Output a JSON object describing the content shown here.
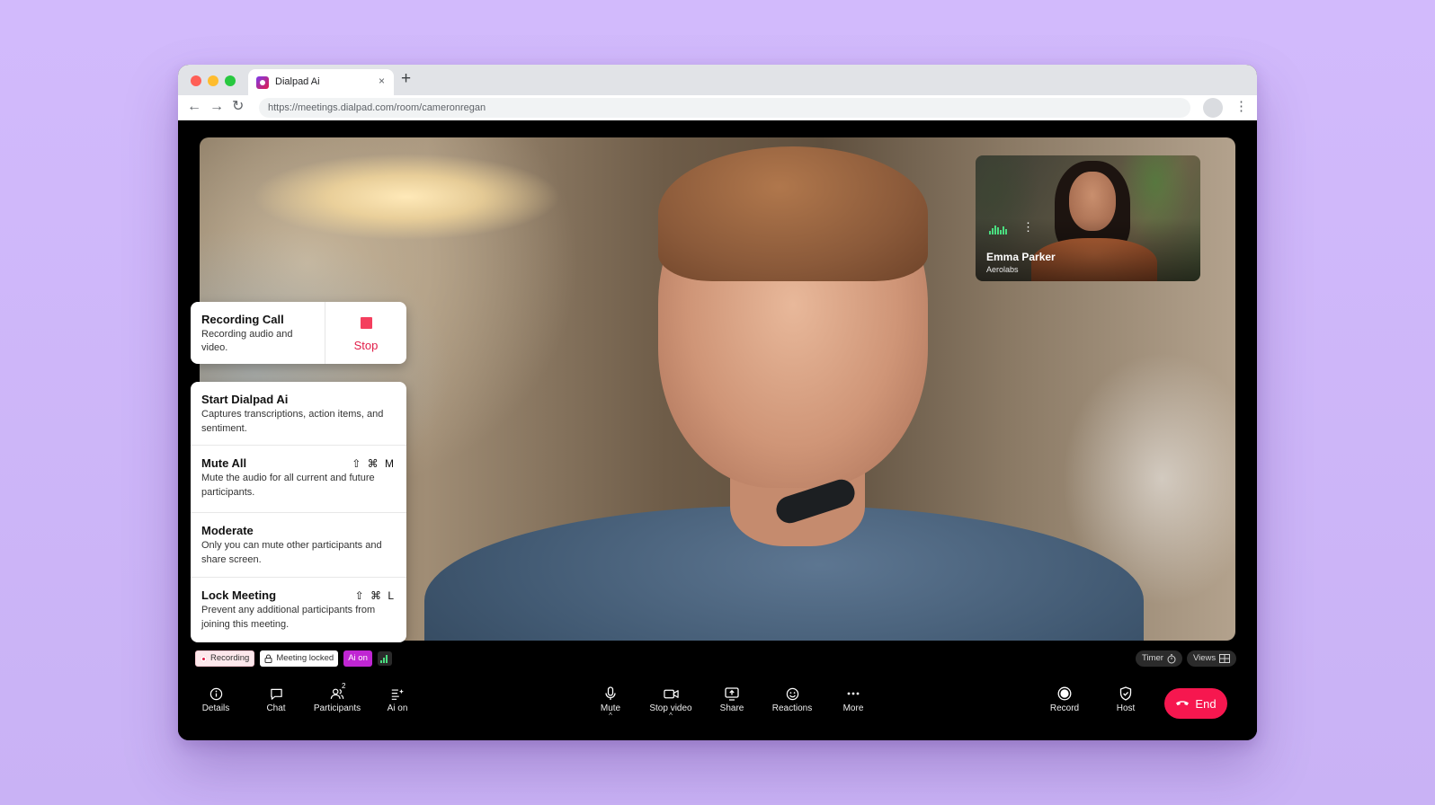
{
  "browser": {
    "tab_title": "Dialpad Ai",
    "tab_close": "×",
    "new_tab": "+",
    "url": "https://meetings.dialpad.com/room/cameronregan",
    "back": "←",
    "forward": "→",
    "reload": "↻",
    "menu": "⋮",
    "traffic_colors": [
      "#ff5f57",
      "#febc2e",
      "#28c840"
    ]
  },
  "pip": {
    "name": "Emma Parker",
    "org": "Aerolabs",
    "more": "⋮"
  },
  "recording_card": {
    "title": "Recording Call",
    "description": "Recording audio and video.",
    "stop_label": "Stop"
  },
  "host_menu": {
    "items": [
      {
        "title": "Start Dialpad Ai",
        "description": "Captures transcriptions, action items, and sentiment.",
        "shortcut": ""
      },
      {
        "title": "Mute All",
        "description": "Mute the audio for all current and future participants.",
        "shortcut": "⇧ ⌘ M"
      },
      {
        "title": "Moderate",
        "description": "Only you can mute other participants and share screen.",
        "shortcut": ""
      },
      {
        "title": "Lock Meeting",
        "description": "Prevent any additional participants from joining this meeting.",
        "shortcut": "⇧ ⌘ L"
      }
    ]
  },
  "status": {
    "recording": "Recording",
    "locked": "Meeting locked",
    "ai": "Ai on"
  },
  "view_controls": {
    "timer": "Timer",
    "views": "Views"
  },
  "controls": {
    "left": [
      {
        "label": "Details",
        "icon": "info-icon"
      },
      {
        "label": "Chat",
        "icon": "chat-icon"
      },
      {
        "label": "Participants",
        "icon": "participants-icon",
        "count": "2"
      },
      {
        "label": "Ai on",
        "icon": "ai-icon"
      }
    ],
    "center": [
      {
        "label": "Mute",
        "icon": "microphone-icon"
      },
      {
        "label": "Stop video",
        "icon": "video-camera-icon"
      },
      {
        "label": "Share",
        "icon": "share-screen-icon"
      },
      {
        "label": "Reactions",
        "icon": "smiley-icon"
      },
      {
        "label": "More",
        "icon": "more-horizontal-icon"
      }
    ],
    "right": [
      {
        "label": "Record",
        "icon": "record-icon"
      },
      {
        "label": "Host",
        "icon": "shield-icon"
      }
    ],
    "end_label": "End"
  },
  "colors": {
    "end_button": "#f6174f",
    "accent_ai": "#c026d3",
    "record_red": "#e11d48",
    "page_background": "#d2bafc"
  }
}
